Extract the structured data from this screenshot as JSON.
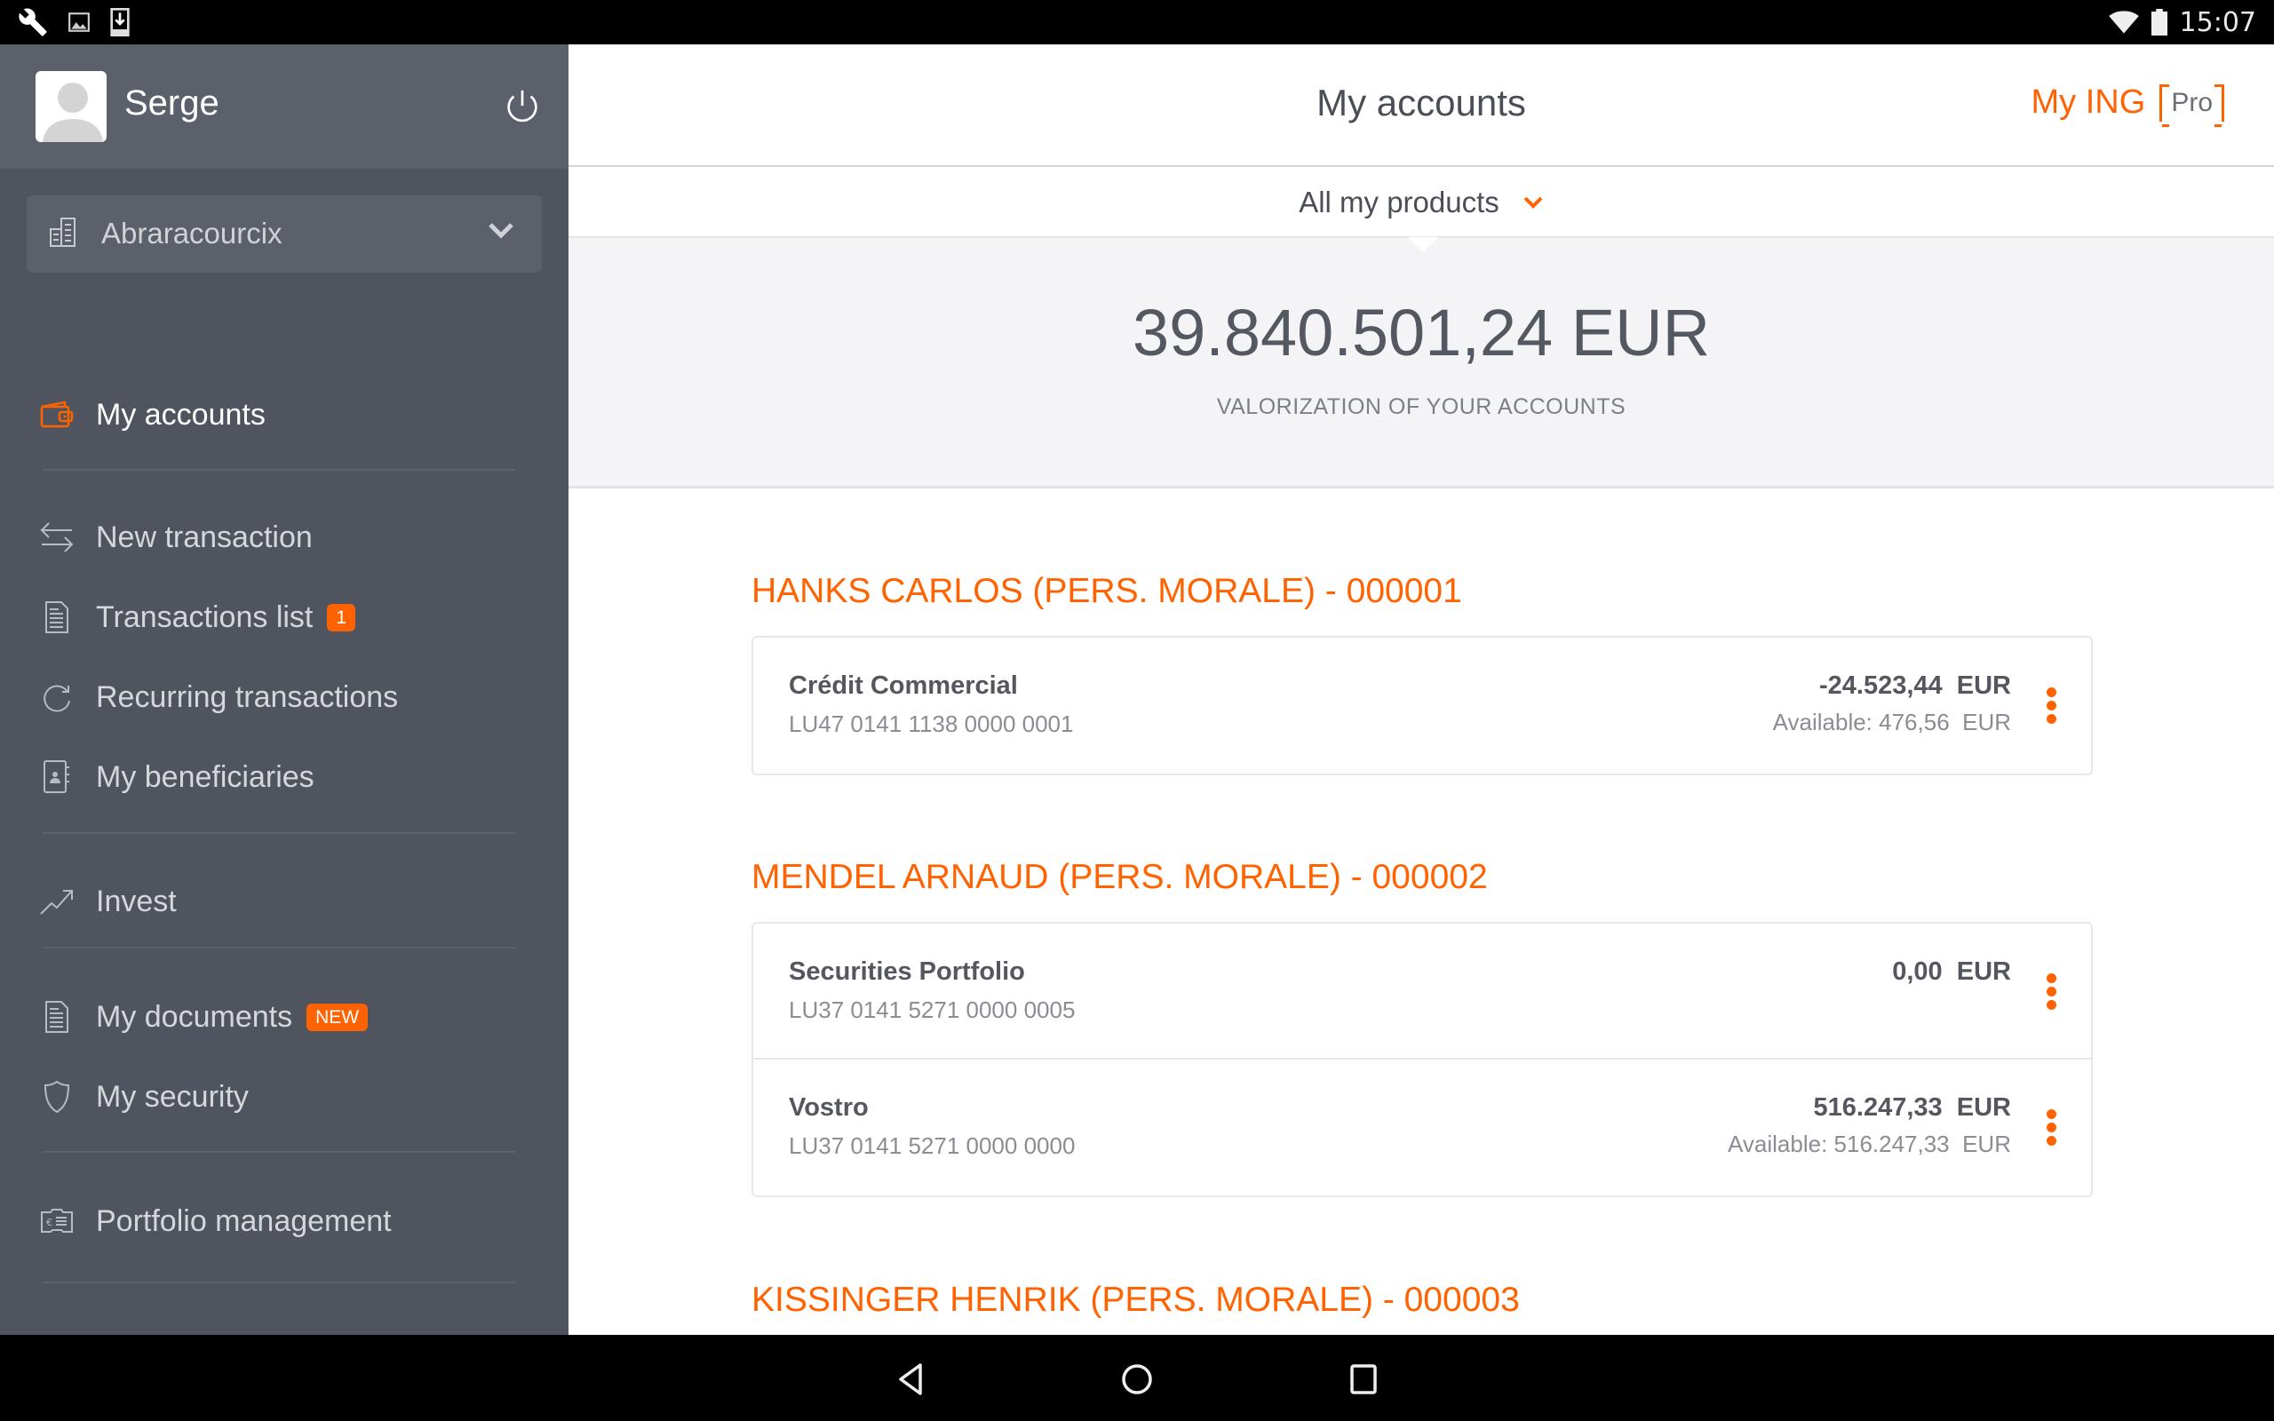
{
  "status_bar": {
    "left_icons": [
      "wrench-icon",
      "image-icon",
      "download-icon"
    ],
    "right_icons": [
      "wifi-icon",
      "battery-icon"
    ],
    "time": "15:07"
  },
  "sidebar": {
    "user_name": "Serge",
    "company": "Abraracourcix",
    "items": [
      {
        "label": "My accounts",
        "icon": "wallet-icon",
        "active": true
      },
      {
        "label": "New transaction",
        "icon": "transfer-arrows-icon"
      },
      {
        "label": "Transactions list",
        "icon": "document-icon",
        "badge": "1"
      },
      {
        "label": "Recurring transactions",
        "icon": "recurring-icon"
      },
      {
        "label": "My beneficiaries",
        "icon": "address-book-icon"
      },
      {
        "label": "Invest",
        "icon": "trend-up-icon"
      },
      {
        "label": "My documents",
        "icon": "document-icon",
        "badge": "NEW"
      },
      {
        "label": "My security",
        "icon": "shield-icon"
      },
      {
        "label": "Portfolio management",
        "icon": "portfolio-euro-icon"
      }
    ]
  },
  "header": {
    "title": "My accounts",
    "brand": "My ING",
    "brand_tag": "Pro"
  },
  "filter": {
    "selected": "All my products"
  },
  "summary": {
    "total": "39.840.501,24 EUR",
    "label": "VALORIZATION OF YOUR ACCOUNTS"
  },
  "groups": [
    {
      "title": "HANKS CARLOS (PERS. MORALE) - 000001",
      "accounts": [
        {
          "name": "Crédit Commercial",
          "iban": "LU47 0141 1138 0000 0001",
          "balance": "-24.523,44  EUR",
          "available": "Available: 476,56  EUR"
        }
      ]
    },
    {
      "title": "MENDEL ARNAUD (PERS. MORALE) - 000002",
      "accounts": [
        {
          "name": "Securities Portfolio",
          "iban": "LU37 0141 5271 0000 0005",
          "balance": "0,00  EUR",
          "available": ""
        },
        {
          "name": "Vostro",
          "iban": "LU37 0141 5271 0000 0000",
          "balance": "516.247,33  EUR",
          "available": "Available: 516.247,33  EUR"
        }
      ]
    },
    {
      "title": "KISSINGER HENRIK (PERS. MORALE) - 000003",
      "accounts": []
    }
  ],
  "colors": {
    "accent": "#ff6200",
    "sidebar_bg": "#4f545e",
    "sidebar_header_bg": "#5b606b",
    "summary_bg": "#f4f4f6"
  }
}
